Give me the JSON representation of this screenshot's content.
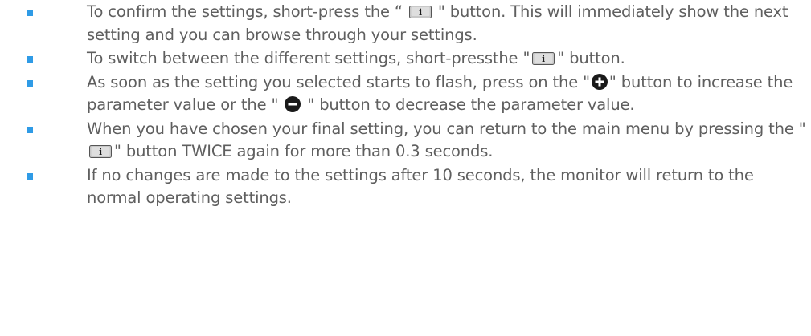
{
  "colors": {
    "bullet": "#2f9be6",
    "text": "#5f5f5f",
    "icon": "#1a1a1a"
  },
  "icons": {
    "info": "info-key-icon",
    "plus": "plus-circle-icon",
    "minus": "minus-circle-icon"
  },
  "items": [
    {
      "parts": [
        "To confirm the settings, short-press the “",
        "\" button. This will immediately show the next setting and you can browse through your settings."
      ]
    },
    {
      "parts": [
        "To switch between the different settings, short-pressthe \"",
        "\" button."
      ]
    },
    {
      "parts": [
        "As soon as the setting you selected starts to flash, press on the \"",
        "\" button to increase the parameter value or the \"",
        "\" button to decrease the parameter value."
      ]
    },
    {
      "parts": [
        " When you have chosen your final setting, you can return to the main menu by pressing the \"",
        "\" button TWICE again for more than 0.3 seconds."
      ]
    },
    {
      "parts": [
        "If no changes are made to the settings after 10 seconds, the monitor will return to the normal operating settings."
      ]
    }
  ]
}
